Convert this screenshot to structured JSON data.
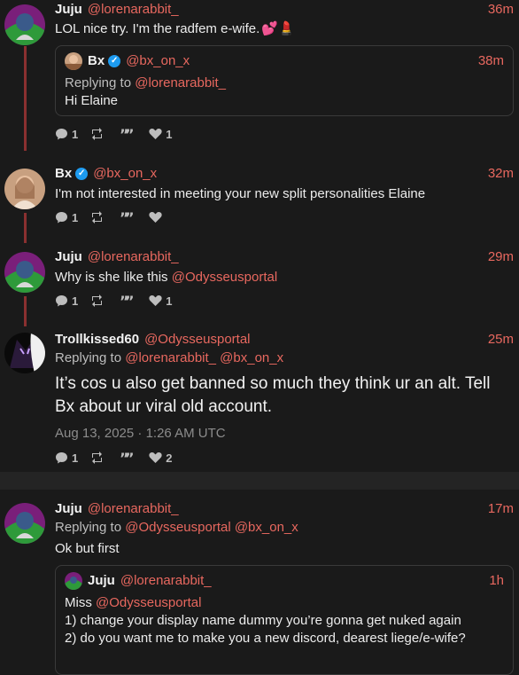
{
  "tweets": [
    {
      "name": "Juju",
      "handle": "@lorenarabbit_",
      "time": "36m",
      "text": "LOL nice try. I'm the radfem e-wife.",
      "quote": {
        "name": "Bx",
        "handle": "@bx_on_x",
        "time": "38m",
        "replying_prefix": "Replying to",
        "replying_handle": "@lorenarabbit_",
        "text": "Hi Elaine"
      },
      "stats": {
        "replies": "1",
        "retweets": "",
        "quotes": "",
        "likes": "1"
      }
    },
    {
      "name": "Bx",
      "handle": "@bx_on_x",
      "time": "32m",
      "text": "I'm not interested in meeting your new split personalities Elaine",
      "stats": {
        "replies": "1",
        "retweets": "",
        "quotes": "",
        "likes": ""
      }
    },
    {
      "name": "Juju",
      "handle": "@lorenarabbit_",
      "time": "29m",
      "text_prefix": "Why is she like this",
      "mention": "@Odysseusportal",
      "stats": {
        "replies": "1",
        "retweets": "",
        "quotes": "",
        "likes": "1"
      }
    },
    {
      "name": "Trollkissed60",
      "handle": "@Odysseusportal",
      "time": "25m",
      "replying_prefix": "Replying to",
      "replying_handles": "@lorenarabbit_ @bx_on_x",
      "text": "It’s cos u also get banned so much they think ur an alt. Tell Bx about ur viral old account.",
      "date": "Aug 13, 2025 · 1:26 AM UTC",
      "stats": {
        "replies": "1",
        "retweets": "",
        "quotes": "",
        "likes": "2"
      }
    },
    {
      "name": "Juju",
      "handle": "@lorenarabbit_",
      "time": "17m",
      "replying_prefix": "Replying to",
      "replying_handles": "@Odysseusportal @bx_on_x",
      "text": "Ok but first",
      "quote": {
        "name": "Juju",
        "handle": "@lorenarabbit_",
        "time": "1h",
        "line1_prefix": "Miss",
        "line1_mention": "@Odysseusportal",
        "line2": "1) change your display name dummy you’re gonna get nuked again",
        "line3": "2) do you want me to make you a new discord, dearest liege/e-wife?"
      }
    }
  ],
  "colors": {
    "accent": "#e8685f",
    "thread": "#8a3030",
    "verified": "#1d9bf0"
  }
}
